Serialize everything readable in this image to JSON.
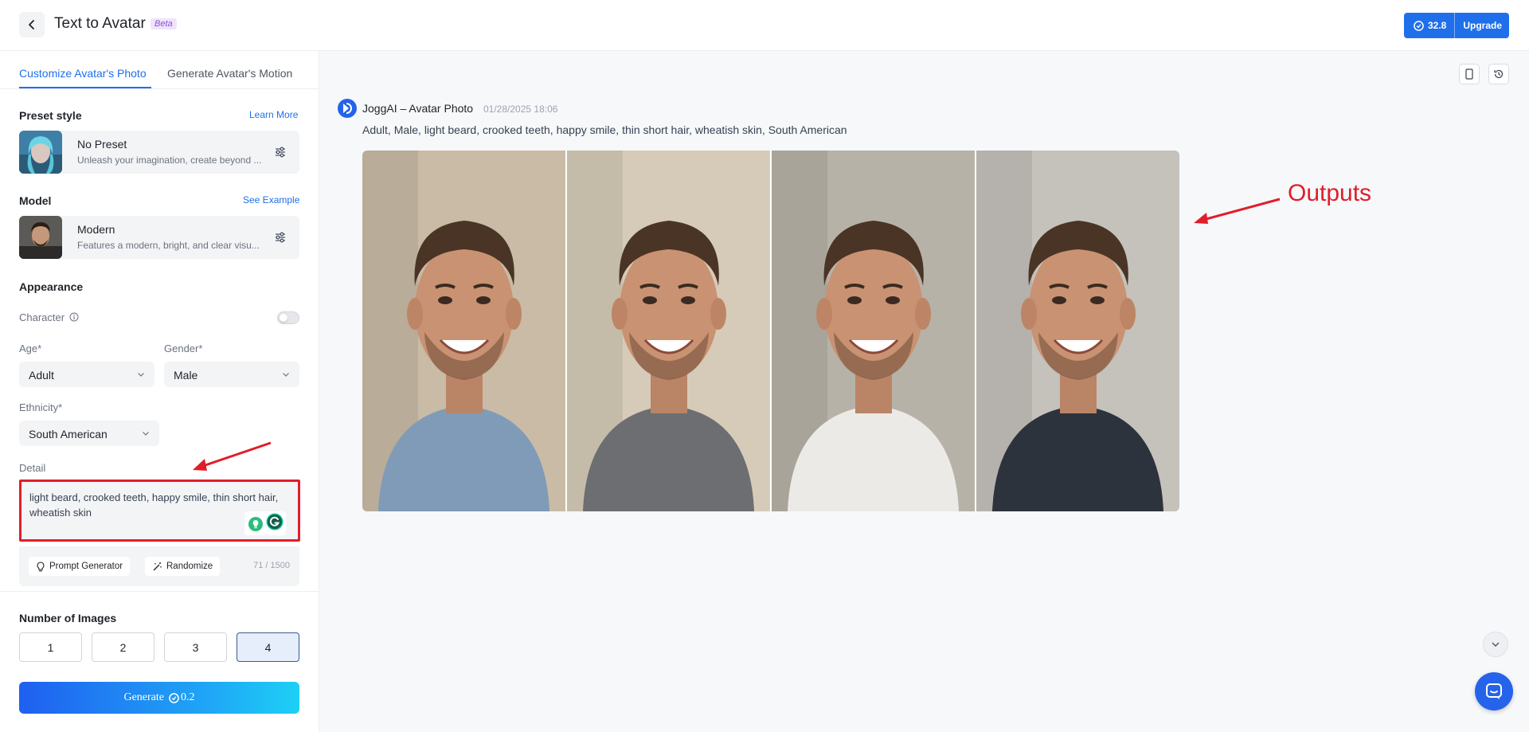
{
  "header": {
    "title": "Text to Avatar",
    "badge": "Beta",
    "credits": "32.8",
    "upgrade_label": "Upgrade"
  },
  "tabs": [
    {
      "label": "Customize Avatar's Photo",
      "active": true
    },
    {
      "label": "Generate Avatar's Motion",
      "active": false
    }
  ],
  "preset": {
    "section_label": "Preset style",
    "link": "Learn More",
    "title": "No Preset",
    "desc": "Unleash your imagination, create beyond ..."
  },
  "model": {
    "section_label": "Model",
    "link": "See Example",
    "title": "Modern",
    "desc": "Features a modern, bright, and clear visu..."
  },
  "appearance": {
    "section_label": "Appearance",
    "character_label": "Character",
    "character_enabled": false,
    "age_label": "Age*",
    "age_value": "Adult",
    "gender_label": "Gender*",
    "gender_value": "Male",
    "ethnicity_label": "Ethnicity*",
    "ethnicity_value": "South American"
  },
  "detail": {
    "label": "Detail",
    "text": "light beard, crooked teeth, happy smile, thin short hair, wheatish skin",
    "prompt_generator": "Prompt Generator",
    "randomize": "Randomize",
    "counter": "71 / 1500"
  },
  "images": {
    "label": "Number of Images",
    "options": [
      "1",
      "2",
      "3",
      "4"
    ],
    "selected": "4"
  },
  "generate": {
    "label": "Generate",
    "cost": "0.2"
  },
  "result": {
    "source": "JoggAI – Avatar Photo",
    "timestamp": "01/28/2025 18:06",
    "prompt": "Adult, Male, light beard, crooked teeth, happy smile, thin short hair, wheatish skin, South American",
    "photos": [
      {
        "shirt": "#7f9bb8",
        "bg": "#c9bba5"
      },
      {
        "shirt": "#6c6e72",
        "bg": "#d6cbb8"
      },
      {
        "shirt": "#eceae6",
        "bg": "#b7b2a8"
      },
      {
        "shirt": "#2d333c",
        "bg": "#c5c1bb"
      }
    ]
  },
  "annotation": {
    "label": "Outputs",
    "color": "#e11d2a"
  },
  "colors": {
    "accent": "#1f6feb"
  }
}
